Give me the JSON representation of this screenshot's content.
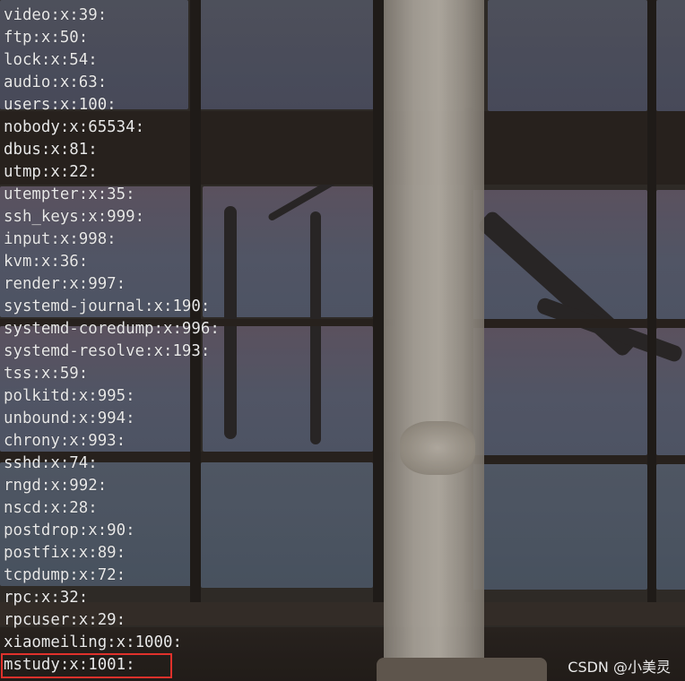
{
  "terminal": {
    "lines": [
      "video:x:39:",
      "ftp:x:50:",
      "lock:x:54:",
      "audio:x:63:",
      "users:x:100:",
      "nobody:x:65534:",
      "dbus:x:81:",
      "utmp:x:22:",
      "utempter:x:35:",
      "ssh_keys:x:999:",
      "input:x:998:",
      "kvm:x:36:",
      "render:x:997:",
      "systemd-journal:x:190:",
      "systemd-coredump:x:996:",
      "systemd-resolve:x:193:",
      "tss:x:59:",
      "polkitd:x:995:",
      "unbound:x:994:",
      "chrony:x:993:",
      "sshd:x:74:",
      "rngd:x:992:",
      "nscd:x:28:",
      "postdrop:x:90:",
      "postfix:x:89:",
      "tcpdump:x:72:",
      "rpc:x:32:",
      "rpcuser:x:29:",
      "xiaomeiling:x:1000:",
      "mstudy:x:1001:"
    ]
  },
  "watermark": "CSDN @小美灵",
  "colors": {
    "text": "#e8e8e8",
    "highlight_border": "#e0312b"
  }
}
